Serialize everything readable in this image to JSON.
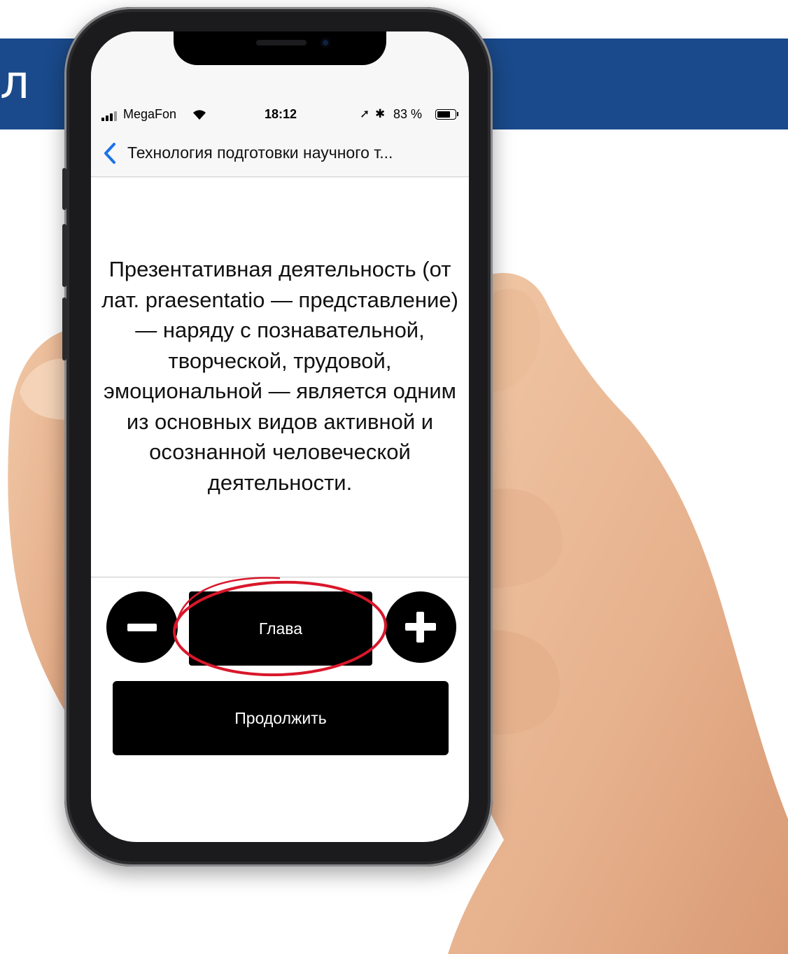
{
  "banner": {
    "text": "л",
    "color": "#1a4a8b"
  },
  "status_bar": {
    "carrier": "MegaFon",
    "time": "18:12",
    "battery": "83 %",
    "battery_level": 0.83,
    "icons": [
      "signal-icon",
      "wifi-icon",
      "location-icon",
      "bluetooth-icon",
      "battery-icon"
    ]
  },
  "nav": {
    "back_icon": "chevron-left-icon",
    "title": "Технология подготовки научного т..."
  },
  "content": {
    "text": "Презентативная деятельность (от лат. praesentatio — представление) — наряду с познавательной, творческой, трудовой, эмоциональной — является одним из основных видов активной и осознанной человеческой деятельности."
  },
  "controls": {
    "minus_icon": "minus-icon",
    "chapter_label": "Глава",
    "plus_icon": "plus-icon",
    "continue_label": "Продолжить",
    "highlight_color": "#d9172b"
  }
}
